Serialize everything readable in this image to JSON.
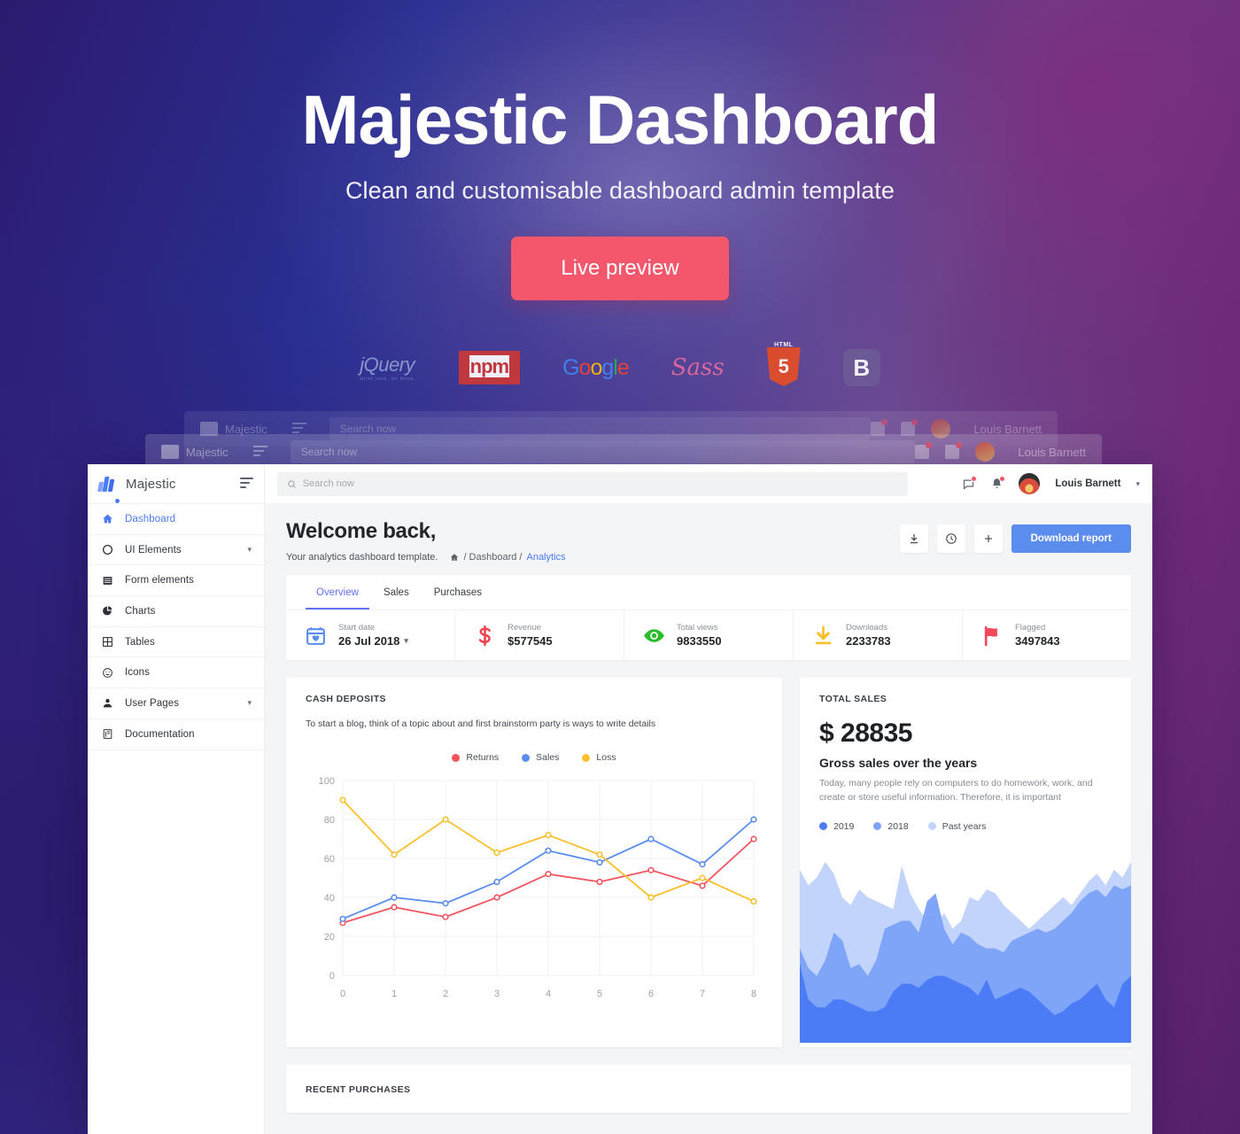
{
  "hero": {
    "title": "Majestic Dashboard",
    "subtitle": "Clean and customisable dashboard admin template",
    "cta_label": "Live preview"
  },
  "logos": [
    {
      "name": "jquery-logo",
      "text": "jQuery",
      "sub": "write less. do more."
    },
    {
      "name": "npm-logo",
      "text": "npm"
    },
    {
      "name": "google-logo",
      "text": "Google"
    },
    {
      "name": "sass-logo",
      "text": "Sass"
    },
    {
      "name": "html5-logo",
      "text": "5",
      "tag": "HTML"
    },
    {
      "name": "bootstrap-logo",
      "text": "B"
    }
  ],
  "app": {
    "brand": {
      "name": "Majestic"
    },
    "sidebar": {
      "items": [
        {
          "label": "Dashboard",
          "icon": "home-icon",
          "active": true,
          "caret": false
        },
        {
          "label": "UI Elements",
          "icon": "circle-icon",
          "active": false,
          "caret": true
        },
        {
          "label": "Form elements",
          "icon": "form-icon",
          "active": false,
          "caret": false
        },
        {
          "label": "Charts",
          "icon": "pie-icon",
          "active": false,
          "caret": false
        },
        {
          "label": "Tables",
          "icon": "table-icon",
          "active": false,
          "caret": false
        },
        {
          "label": "Icons",
          "icon": "smile-icon",
          "active": false,
          "caret": false
        },
        {
          "label": "User Pages",
          "icon": "user-icon",
          "active": false,
          "caret": true
        },
        {
          "label": "Documentation",
          "icon": "book-icon",
          "active": false,
          "caret": false
        }
      ]
    },
    "topbar": {
      "search_placeholder": "Search now",
      "search_value": "",
      "user_name": "Louis Barnett"
    },
    "welcome": {
      "title": "Welcome back,",
      "subtitle": "Your analytics dashboard template.",
      "breadcrumb": {
        "home": "",
        "dashboard": "/ Dashboard /",
        "current": "Analytics"
      },
      "download_label": "Download report"
    },
    "stats": {
      "tabs": [
        {
          "label": "Overview",
          "active": true
        },
        {
          "label": "Sales",
          "active": false
        },
        {
          "label": "Purchases",
          "active": false
        }
      ],
      "kpis": [
        {
          "label": "Start date",
          "value": "26 Jul 2018",
          "icon": "calendar-heart-icon",
          "color": "#5b8def",
          "caret": true
        },
        {
          "label": "Revenue",
          "value": "$577545",
          "icon": "dollar-icon",
          "color": "#f2414f",
          "caret": false
        },
        {
          "label": "Total views",
          "value": "9833550",
          "icon": "eye-icon",
          "color": "#2bbd2b",
          "caret": false
        },
        {
          "label": "Downloads",
          "value": "2233783",
          "icon": "download-icon",
          "color": "#fbc02d",
          "caret": false
        },
        {
          "label": "Flagged",
          "value": "3497843",
          "icon": "flag-icon",
          "color": "#f4485c",
          "caret": false
        }
      ]
    },
    "cash_deposits": {
      "kicker": "CASH DEPOSITS",
      "description": "To start a blog, think of a topic about and first brainstorm party is ways to write details"
    },
    "total_sales": {
      "kicker": "TOTAL SALES",
      "amount": "$ 28835",
      "heading": "Gross sales over the years",
      "body": "Today, many people rely on computers to do homework, work, and create or store useful information. Therefore, it is important",
      "legend": [
        {
          "label": "2019",
          "color": "#4b7bf5"
        },
        {
          "label": "2018",
          "color": "#7fa5f8"
        },
        {
          "label": "Past years",
          "color": "#c2d4fb"
        }
      ]
    },
    "recent_purchases": {
      "kicker": "RECENT PURCHASES"
    }
  },
  "chart_data": [
    {
      "type": "line",
      "title": "CASH DEPOSITS",
      "xlabel": "",
      "ylabel": "",
      "x": [
        0,
        1,
        2,
        3,
        4,
        5,
        6,
        7,
        8
      ],
      "xticks": [
        "0",
        "1",
        "2",
        "3",
        "4",
        "5",
        "6",
        "7",
        "8"
      ],
      "yticks": [
        "0",
        "20",
        "40",
        "60",
        "80",
        "100"
      ],
      "ylim": [
        0,
        100
      ],
      "grid": true,
      "legend_position": "top-center",
      "series": [
        {
          "name": "Returns",
          "color": "#f2555f",
          "values": [
            27,
            35,
            30,
            40,
            52,
            48,
            54,
            46,
            70
          ]
        },
        {
          "name": "Sales",
          "color": "#5b8def",
          "values": [
            29,
            40,
            37,
            48,
            64,
            58,
            70,
            57,
            80
          ]
        },
        {
          "name": "Loss",
          "color": "#fbc02d",
          "values": [
            90,
            62,
            80,
            63,
            72,
            62,
            40,
            50,
            38
          ]
        }
      ]
    },
    {
      "type": "area",
      "title": "Gross sales over the years",
      "stacked": false,
      "grid": false,
      "ylim": [
        0,
        100
      ],
      "legend_position": "above",
      "series": [
        {
          "name": "Past years",
          "color": "#c2d4fb",
          "values": [
            88,
            80,
            84,
            92,
            86,
            74,
            70,
            78,
            74,
            72,
            70,
            68,
            90,
            76,
            68,
            62,
            60,
            66,
            58,
            62,
            74,
            72,
            78,
            76,
            70,
            66,
            62,
            58,
            62,
            66,
            70,
            74,
            70,
            76,
            82,
            86,
            80,
            88,
            84,
            92
          ]
        },
        {
          "name": "2018",
          "color": "#7fa5f8",
          "values": [
            48,
            38,
            34,
            42,
            56,
            52,
            38,
            40,
            34,
            42,
            58,
            60,
            62,
            62,
            56,
            72,
            76,
            58,
            50,
            56,
            54,
            50,
            48,
            48,
            46,
            52,
            54,
            56,
            58,
            56,
            58,
            62,
            66,
            72,
            76,
            78,
            74,
            80,
            78,
            80
          ]
        },
        {
          "name": "2019",
          "color": "#4b7bf5",
          "values": [
            40,
            22,
            18,
            18,
            22,
            22,
            20,
            18,
            16,
            16,
            18,
            26,
            30,
            30,
            28,
            32,
            34,
            34,
            32,
            30,
            28,
            24,
            32,
            22,
            24,
            26,
            28,
            26,
            22,
            18,
            14,
            16,
            20,
            22,
            26,
            30,
            22,
            18,
            30,
            34
          ]
        }
      ]
    }
  ]
}
